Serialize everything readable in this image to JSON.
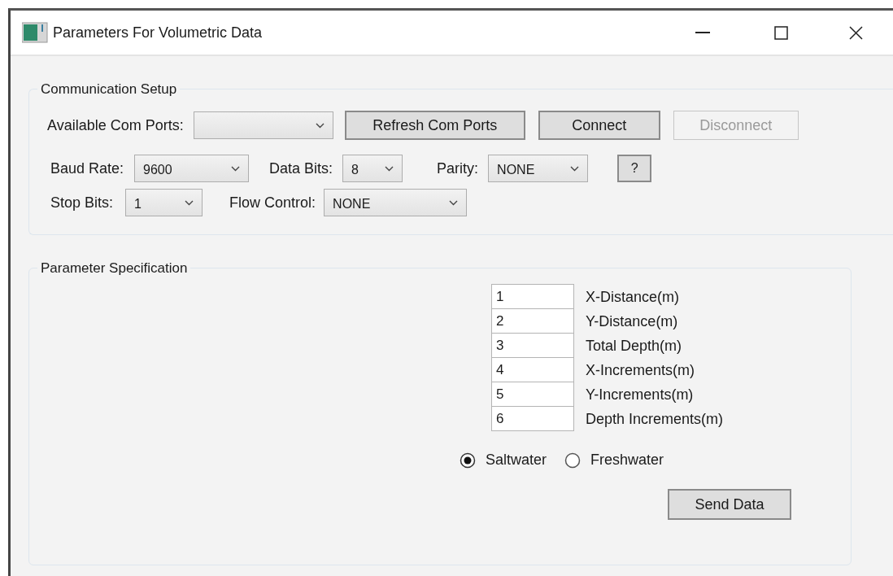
{
  "window": {
    "title": "Parameters For Volumetric Data"
  },
  "communication_setup": {
    "title": "Communication Setup",
    "rows": [
      {
        "items": [
          {
            "kind": "label",
            "text": "Available Com Ports:"
          },
          {
            "kind": "select"
          },
          {
            "kind": "button",
            "text": "Refresh Com Ports",
            "disabled": false
          },
          {
            "kind": "button",
            "text": "Connect",
            "disabled": false
          },
          {
            "kind": "button",
            "text": "Disconnect",
            "disabled": true
          }
        ]
      },
      {
        "items": [
          {
            "kind": "label",
            "text": "Baud Rate:"
          },
          {
            "kind": "select",
            "value": "9600"
          },
          {
            "kind": "label",
            "text": "Data Bits:"
          },
          {
            "kind": "select",
            "value": "8"
          },
          {
            "kind": "label",
            "text": "Parity:"
          },
          {
            "kind": "select",
            "value": "NONE"
          },
          {
            "kind": "button",
            "text": "?",
            "disabled": false
          }
        ]
      },
      {
        "items": [
          {
            "kind": "label",
            "text": "Stop Bits:"
          },
          {
            "kind": "select",
            "value": "1"
          },
          {
            "kind": "label",
            "text": "Flow Control:"
          },
          {
            "kind": "select",
            "value": "NONE"
          }
        ]
      }
    ]
  },
  "parameter_specification": {
    "title": "Parameter Specification",
    "fields": [
      {
        "value": "1",
        "label": "X-Distance(m)"
      },
      {
        "value": "2",
        "label": "Y-Distance(m)"
      },
      {
        "value": "3",
        "label": "Total Depth(m)"
      },
      {
        "value": "4",
        "label": "X-Increments(m)"
      },
      {
        "value": "5",
        "label": "Y-Increments(m)"
      },
      {
        "value": "6",
        "label": "Depth Increments(m)"
      }
    ],
    "water_type": [
      {
        "label": "Saltwater",
        "selected": true
      },
      {
        "label": "Freshwater",
        "selected": false
      }
    ],
    "send_button": "Send Data"
  }
}
